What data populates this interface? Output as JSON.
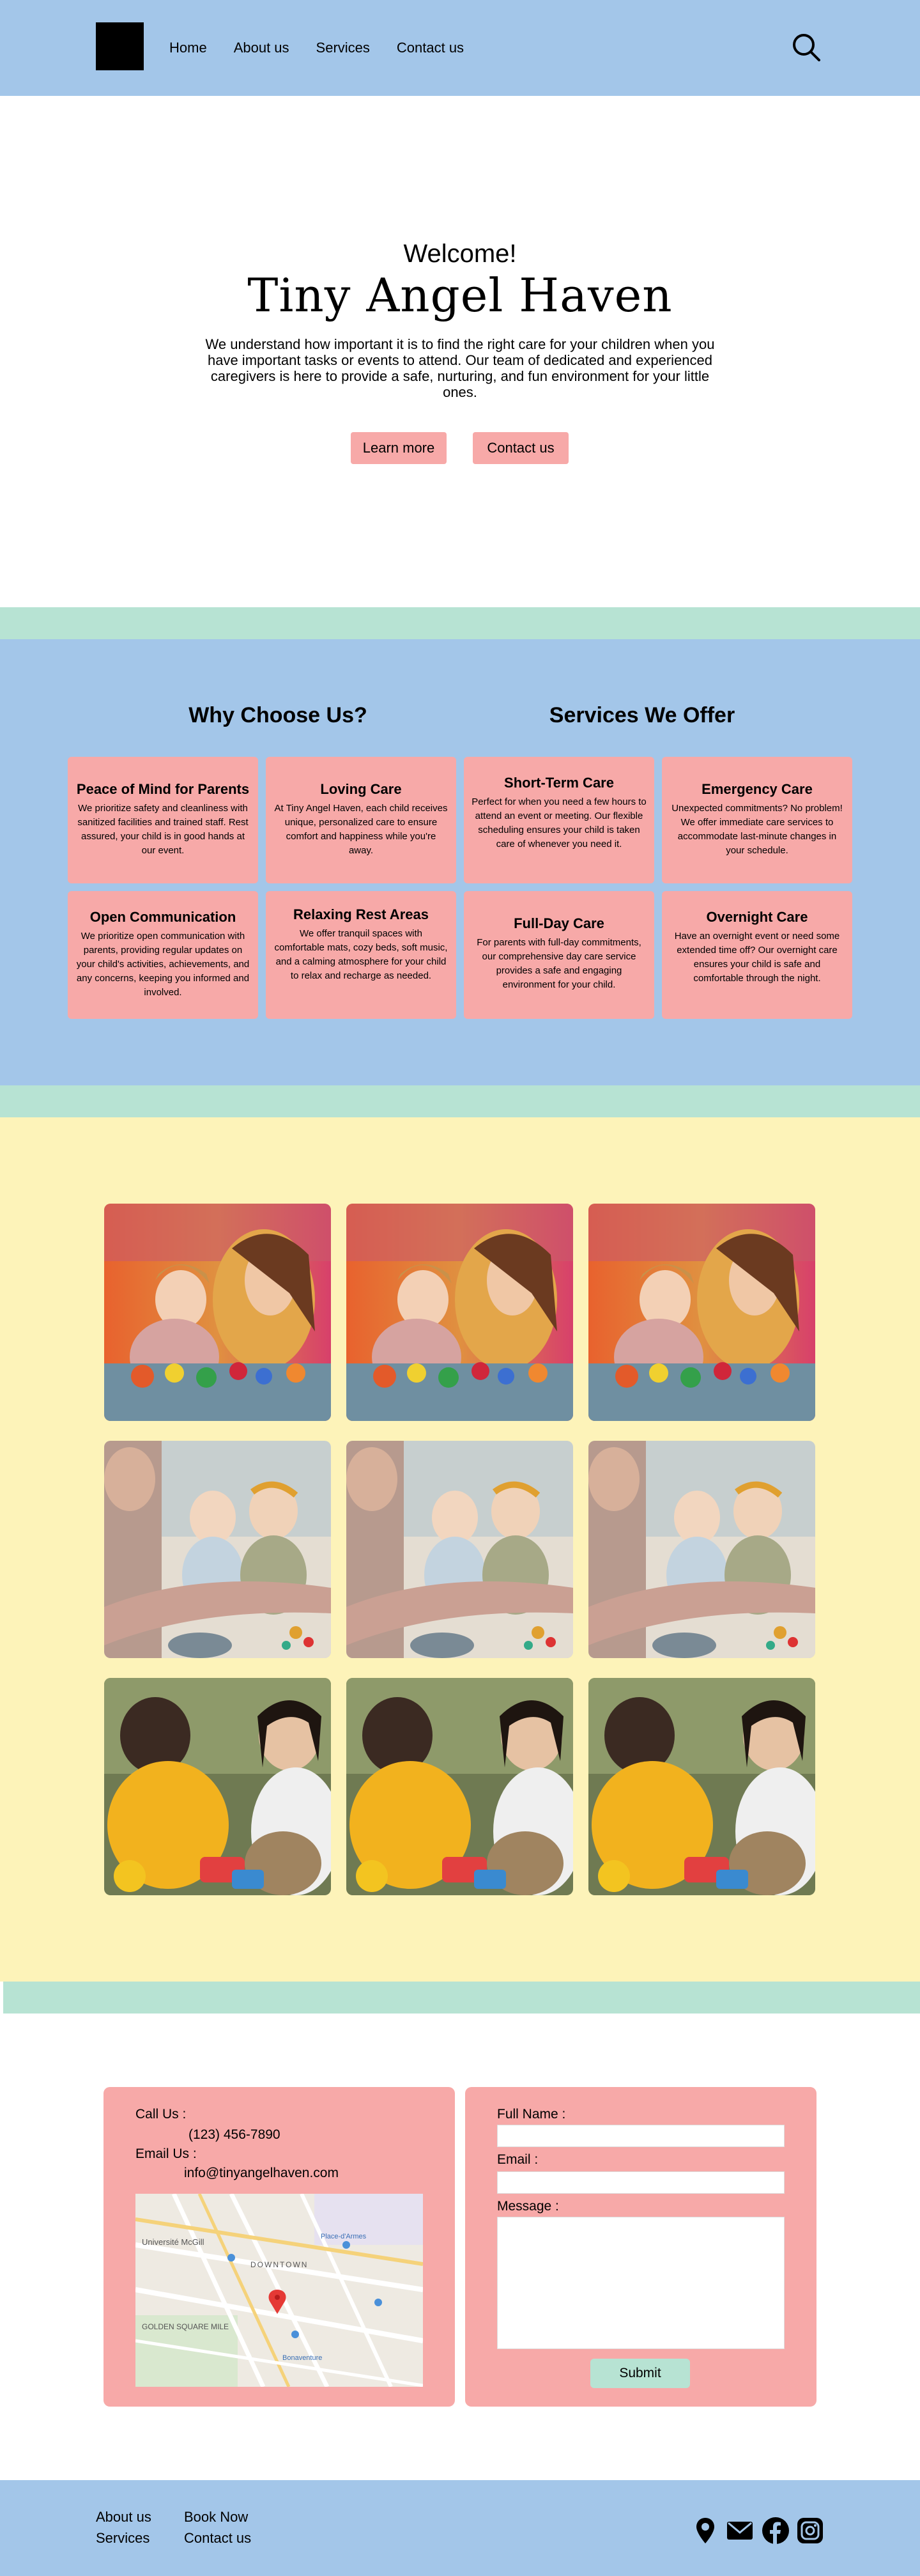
{
  "header": {
    "logo": "black square",
    "nav": [
      "Home",
      "About us",
      "Services",
      "Contact us"
    ],
    "search_icon": "search-icon"
  },
  "hero": {
    "welcome": "Welcome!",
    "title": "Tiny Angel Haven",
    "intro": "We understand how important it is to find the right care for your children when you have important tasks or events to attend. Our team of dedicated and experienced caregivers is here to provide a safe, nurturing, and fun environment for your little ones.",
    "learn_more": "Learn more",
    "contact_us": "Contact us"
  },
  "why": {
    "title": "Why Choose Us?",
    "cards": [
      {
        "title": "Peace of Mind for Parents",
        "text": "We prioritize safety and cleanliness with sanitized facilities and trained staff. Rest assured, your child is in good hands at our event."
      },
      {
        "title": "Loving Care",
        "text": "At Tiny Angel Haven, each child receives unique, personalized care to ensure comfort and happiness while you're away."
      },
      {
        "title": "Open Communication",
        "text": "We prioritize open communication with parents, providing regular updates on your child's activities, achievements, and any concerns, keeping you informed and involved."
      },
      {
        "title": "Relaxing Rest Areas",
        "text": "We offer tranquil spaces with comfortable mats, cozy beds, soft music, and a calming atmosphere for your child to relax and recharge as needed."
      }
    ]
  },
  "services": {
    "title": "Services We Offer",
    "cards": [
      {
        "title": "Short-Term Care",
        "text": "Perfect for when you need a few hours to attend an event or meeting. Our flexible scheduling ensures your child is taken care of whenever you need it."
      },
      {
        "title": "Emergency Care",
        "text": "Unexpected commitments? No problem! We offer immediate care services to accommodate last-minute changes in your schedule."
      },
      {
        "title": "Full-Day Care",
        "text": "For parents with full-day commitments, our comprehensive day care service provides a safe and engaging environment for your child."
      },
      {
        "title": "Overnight Care",
        "text": "Have an overnight event or need some extended time off? Our overnight care ensures your child is safe and comfortable through the night."
      }
    ]
  },
  "gallery": {
    "rows": [
      {
        "subject": "woman and toddler playing with colorful toys"
      },
      {
        "subject": "adult feeding two babies"
      },
      {
        "subject": "two toddlers playing with toys"
      }
    ]
  },
  "contact": {
    "call_label": "Call Us :",
    "phone": "(123) 456-7890",
    "email_label": "Email Us :",
    "email": "info@tinyangelhaven.com",
    "map_labels": [
      "Université McGill",
      "DOWNTOWN",
      "GOLDEN SQUARE MILE",
      "Place-d'Armes",
      "Bonaventure"
    ],
    "form": {
      "name_label": "Full Name :",
      "email_label": "Email :",
      "message_label": "Message :",
      "submit": "Submit"
    }
  },
  "footer": {
    "col1": [
      "About us",
      "Services"
    ],
    "col2": [
      "Book Now",
      "Contact us"
    ],
    "icons": [
      "location-pin-icon",
      "mail-icon",
      "facebook-icon",
      "instagram-icon"
    ]
  },
  "colors": {
    "blue": "#a3c6e9",
    "pink": "#f7a9a8",
    "mint": "#b7e3d3",
    "yellow": "#fdf3b9"
  }
}
